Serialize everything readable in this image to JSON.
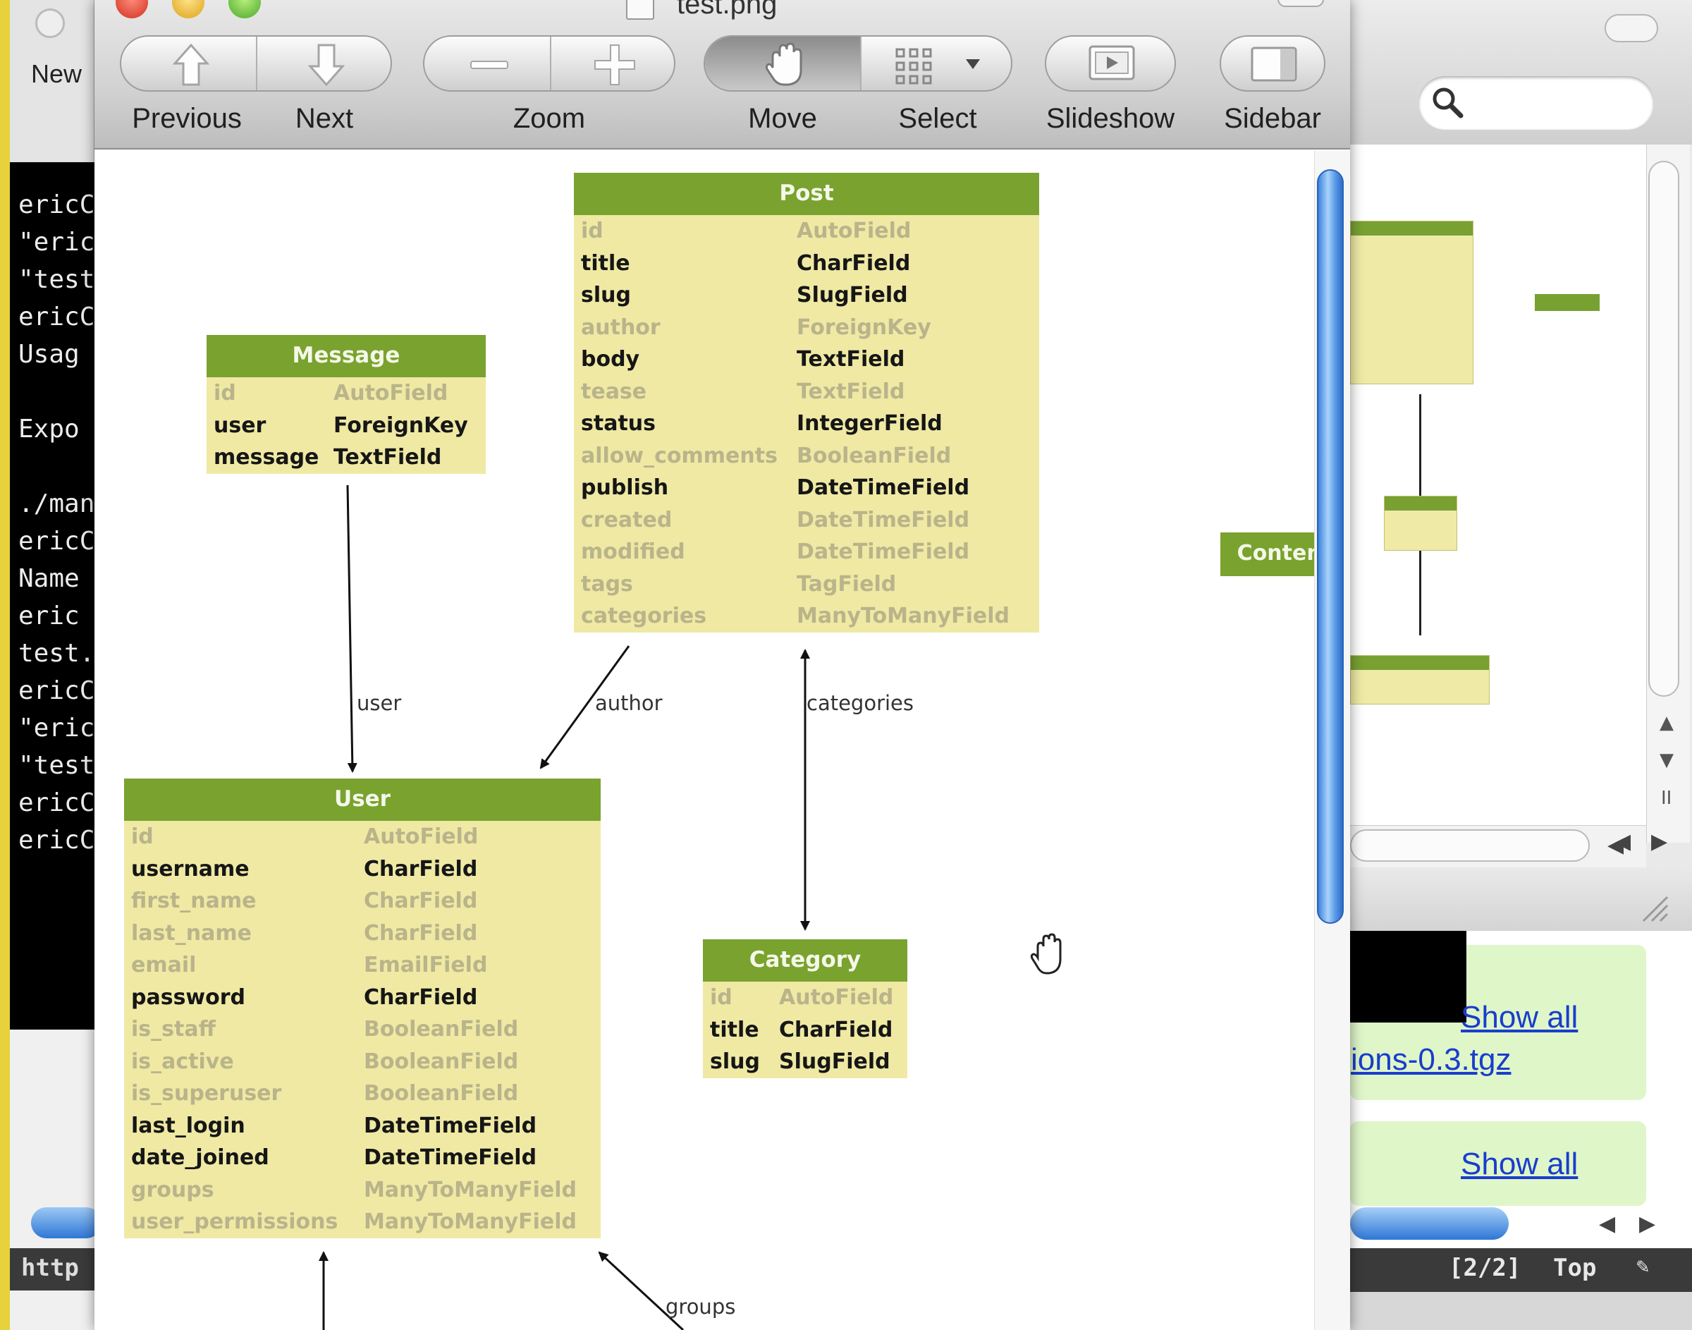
{
  "window": {
    "title": "test.png"
  },
  "toolbar": {
    "previous_label": "Previous",
    "next_label": "Next",
    "zoom_label": "Zoom",
    "move_label": "Move",
    "select_label": "Select",
    "slideshow_label": "Slideshow",
    "sidebar_label": "Sidebar"
  },
  "background_left": {
    "new_label": "New",
    "terminal_lines": [
      "ericC",
      "\"eric",
      "\"test",
      "ericC",
      "Usag",
      "",
      "Expo",
      "",
      "./man",
      "ericC",
      "Name",
      "eric",
      "test.",
      "ericC",
      "\"eric",
      "\"test",
      "ericC",
      "ericC"
    ],
    "status_text": "http"
  },
  "background_right": {
    "link_show_all_1": "Show all",
    "link_file": "ions-0.3.tgz",
    "link_show_all_2": "Show all",
    "status_position": "[2/2]",
    "status_top": "Top"
  },
  "diagram": {
    "tables": {
      "post": {
        "name": "Post",
        "fields": [
          {
            "name": "id",
            "type": "AutoField",
            "style": "dim"
          },
          {
            "name": "title",
            "type": "CharField",
            "style": "key"
          },
          {
            "name": "slug",
            "type": "SlugField",
            "style": "key"
          },
          {
            "name": "author",
            "type": "ForeignKey",
            "style": "dim"
          },
          {
            "name": "body",
            "type": "TextField",
            "style": "key"
          },
          {
            "name": "tease",
            "type": "TextField",
            "style": "dim"
          },
          {
            "name": "status",
            "type": "IntegerField",
            "style": "key"
          },
          {
            "name": "allow_comments",
            "type": "BooleanField",
            "style": "dim"
          },
          {
            "name": "publish",
            "type": "DateTimeField",
            "style": "key"
          },
          {
            "name": "created",
            "type": "DateTimeField",
            "style": "dim"
          },
          {
            "name": "modified",
            "type": "DateTimeField",
            "style": "dim"
          },
          {
            "name": "tags",
            "type": "TagField",
            "style": "dim"
          },
          {
            "name": "categories",
            "type": "ManyToManyField",
            "style": "dim"
          }
        ]
      },
      "message": {
        "name": "Message",
        "fields": [
          {
            "name": "id",
            "type": "AutoField",
            "style": "dim"
          },
          {
            "name": "user",
            "type": "ForeignKey",
            "style": "key"
          },
          {
            "name": "message",
            "type": "TextField",
            "style": "key"
          }
        ]
      },
      "user": {
        "name": "User",
        "fields": [
          {
            "name": "id",
            "type": "AutoField",
            "style": "dim"
          },
          {
            "name": "username",
            "type": "CharField",
            "style": "key"
          },
          {
            "name": "first_name",
            "type": "CharField",
            "style": "dim"
          },
          {
            "name": "last_name",
            "type": "CharField",
            "style": "dim"
          },
          {
            "name": "email",
            "type": "EmailField",
            "style": "dim"
          },
          {
            "name": "password",
            "type": "CharField",
            "style": "key"
          },
          {
            "name": "is_staff",
            "type": "BooleanField",
            "style": "dim"
          },
          {
            "name": "is_active",
            "type": "BooleanField",
            "style": "dim"
          },
          {
            "name": "is_superuser",
            "type": "BooleanField",
            "style": "dim"
          },
          {
            "name": "last_login",
            "type": "DateTimeField",
            "style": "key"
          },
          {
            "name": "date_joined",
            "type": "DateTimeField",
            "style": "key"
          },
          {
            "name": "groups",
            "type": "ManyToManyField",
            "style": "dim"
          },
          {
            "name": "user_permissions",
            "type": "ManyToManyField",
            "style": "dim"
          }
        ]
      },
      "category": {
        "name": "Category",
        "fields": [
          {
            "name": "id",
            "type": "AutoField",
            "style": "dim"
          },
          {
            "name": "title",
            "type": "CharField",
            "style": "key"
          },
          {
            "name": "slug",
            "type": "SlugField",
            "style": "key"
          }
        ]
      },
      "contenttype": {
        "name": "ContentType"
      }
    },
    "edge_labels": {
      "user": "user",
      "author": "author",
      "categories": "categories",
      "groups": "groups"
    }
  },
  "colors": {
    "table_header": "#7aa22f",
    "table_body": "#efe9a4",
    "scroll_accent": "#3d84dc"
  }
}
